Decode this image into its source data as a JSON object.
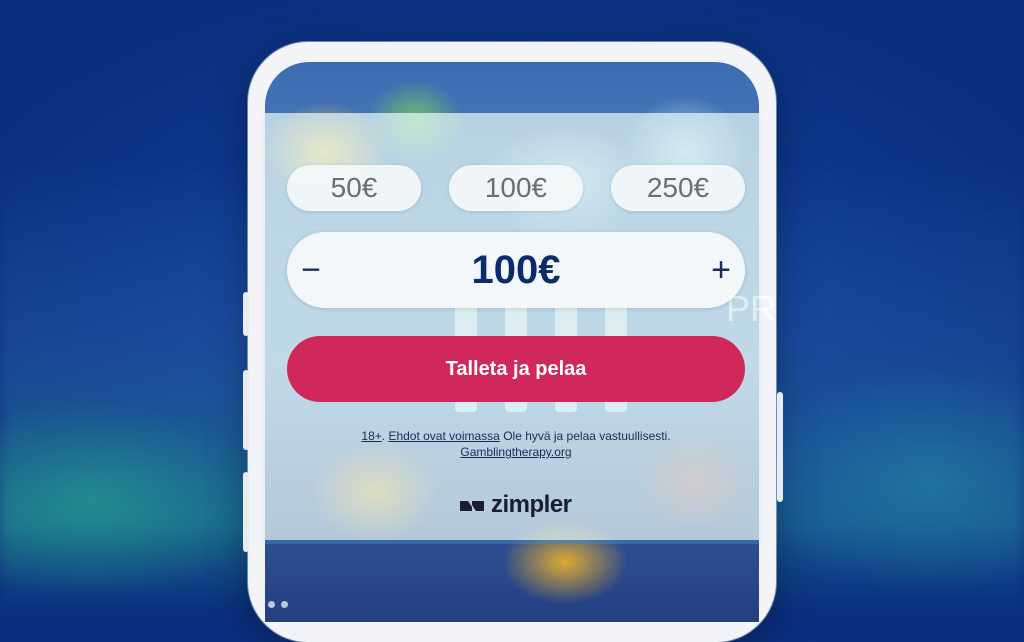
{
  "presets": [
    {
      "label": "50€"
    },
    {
      "label": "100€"
    },
    {
      "label": "250€"
    }
  ],
  "stepper": {
    "decrement_label": "−",
    "amount": "100€",
    "increment_label": "+"
  },
  "cta": {
    "label": "Talleta ja pelaa"
  },
  "legal": {
    "age_link": "18+",
    "sep": ".",
    "terms_link": "Ehdot ovat voimassa",
    "responsible_text": "Ole hyvä ja pelaa vastuullisesti.",
    "therapy_link": "Gamblingtherapy.org"
  },
  "brand": {
    "name": "zimpler",
    "icon": "zimpler-logo-icon"
  },
  "game_bg_text": "PR",
  "colors": {
    "cta": "#d0285b",
    "amount_text": "#0d2a6b",
    "background": "#0f3b92"
  }
}
